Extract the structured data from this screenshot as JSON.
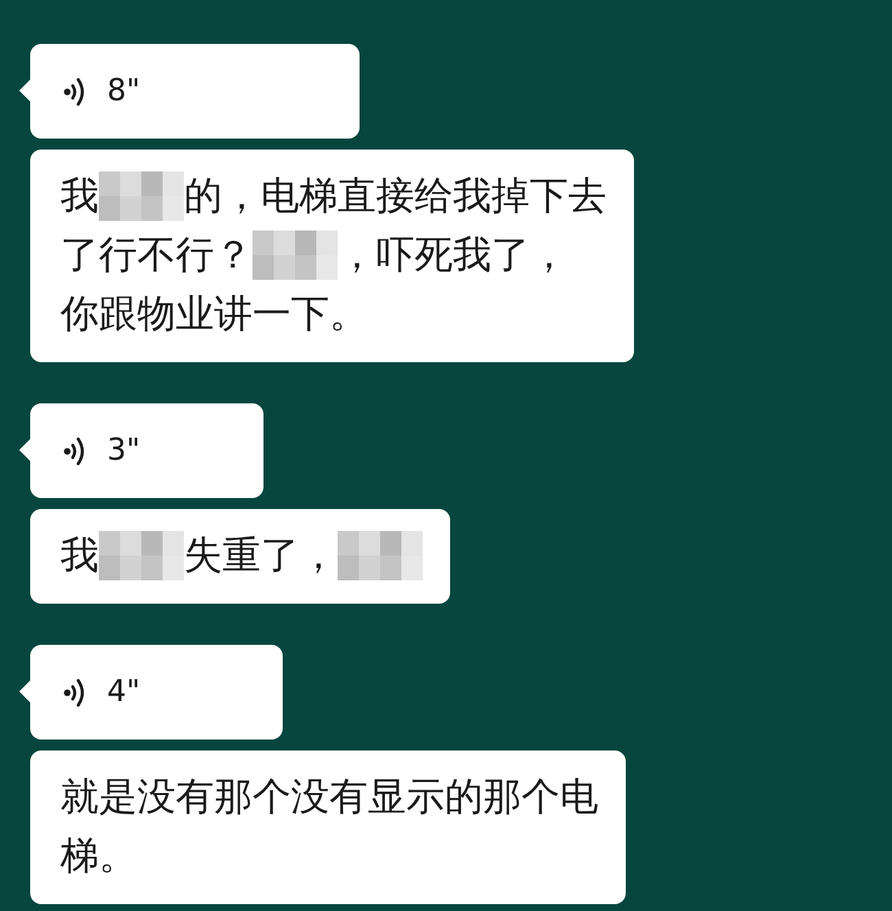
{
  "messages": [
    {
      "kind": "voice",
      "duration": "8\""
    },
    {
      "kind": "text",
      "lines": [
        [
          {
            "kind": "text",
            "text": "我"
          },
          {
            "kind": "redacted"
          },
          {
            "kind": "text",
            "text": "的，电梯直接给我掉下去"
          }
        ],
        [
          {
            "kind": "text",
            "text": "了行不行？"
          },
          {
            "kind": "redacted"
          },
          {
            "kind": "text",
            "text": "，吓死我了，"
          }
        ],
        [
          {
            "kind": "text",
            "text": "你跟物业讲一下。"
          }
        ]
      ]
    },
    {
      "kind": "voice",
      "duration": "3\""
    },
    {
      "kind": "text",
      "lines": [
        [
          {
            "kind": "text",
            "text": "我"
          },
          {
            "kind": "redacted"
          },
          {
            "kind": "text",
            "text": "失重了，"
          },
          {
            "kind": "redacted"
          }
        ]
      ]
    },
    {
      "kind": "voice",
      "duration": "4\""
    },
    {
      "kind": "text",
      "lines": [
        [
          {
            "kind": "text",
            "text": "就是没有那个没有显示的那个电"
          }
        ],
        [
          {
            "kind": "text",
            "text": "梯。"
          }
        ]
      ]
    }
  ]
}
